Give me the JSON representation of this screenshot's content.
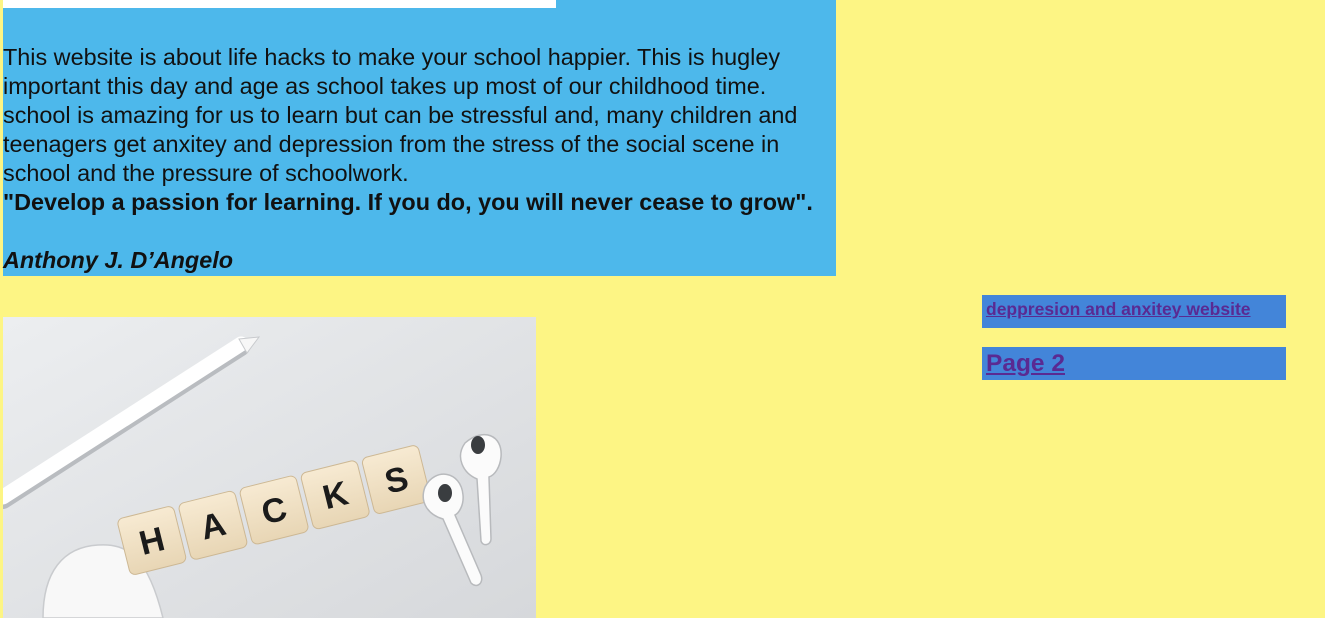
{
  "intro": {
    "paragraph": "This website is about life hacks to make your school happier. This is hugley important this day and age as school takes up most of our childhood time. school is amazing for us to learn but can be stressful and, many children and teenagers get anxitey and depression from the stress of the social scene in school and the pressure of schoolwork.",
    "quote": "\"Develop a passion for learning. If you do, you will never cease to grow\".",
    "author": "Anthony J. D’Angelo"
  },
  "image": {
    "tiles": [
      "H",
      "A",
      "C",
      "K",
      "S"
    ]
  },
  "links": {
    "depression_link": "deppresion and anxitey website",
    "page2_link": "Page 2"
  },
  "colors": {
    "page_background": "#fdf584",
    "intro_background": "#4db8eb",
    "link_background": "#4385d9",
    "link_text": "#5a2a92"
  }
}
